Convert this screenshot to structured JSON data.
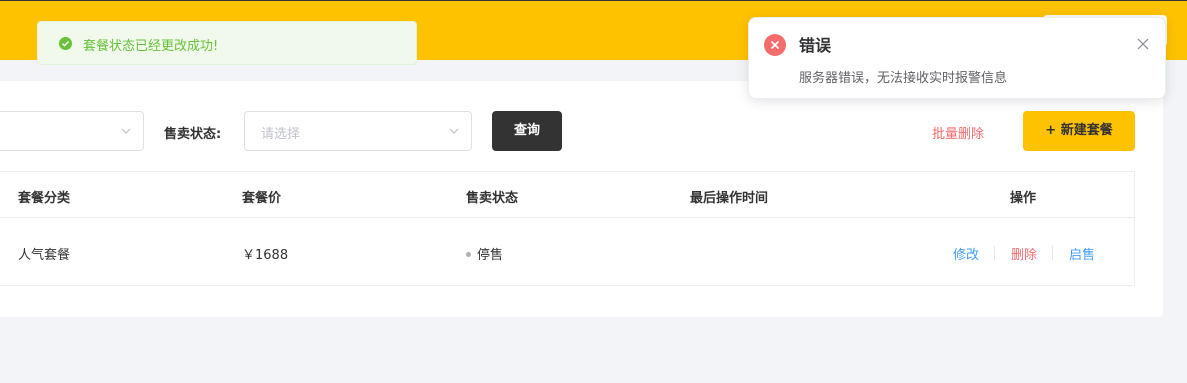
{
  "toast": {
    "message": "套餐状态已经更改成功!",
    "color": "#67c23a"
  },
  "notification": {
    "title": "错误",
    "message": "服务器错误，无法接收实时报警信息",
    "color": "#f56c6c"
  },
  "filters": {
    "status_label": "售卖状态:",
    "status_placeholder": "请选择"
  },
  "toolbar": {
    "query_label": "查询",
    "batch_delete_label": "批量删除",
    "new_label": "+ 新建套餐"
  },
  "table": {
    "headers": [
      "套餐分类",
      "套餐价",
      "售卖状态",
      "最后操作时间",
      "操作"
    ],
    "rows": [
      {
        "category": "人气套餐",
        "price": "￥1688",
        "status": "停售",
        "last_modified": "",
        "actions": [
          "修改",
          "删除",
          "启售"
        ]
      }
    ]
  },
  "colors": {
    "brand": "#ffc200",
    "dark_button": "#333333",
    "link_blue": "#419eff",
    "danger": "#f56c6c"
  }
}
